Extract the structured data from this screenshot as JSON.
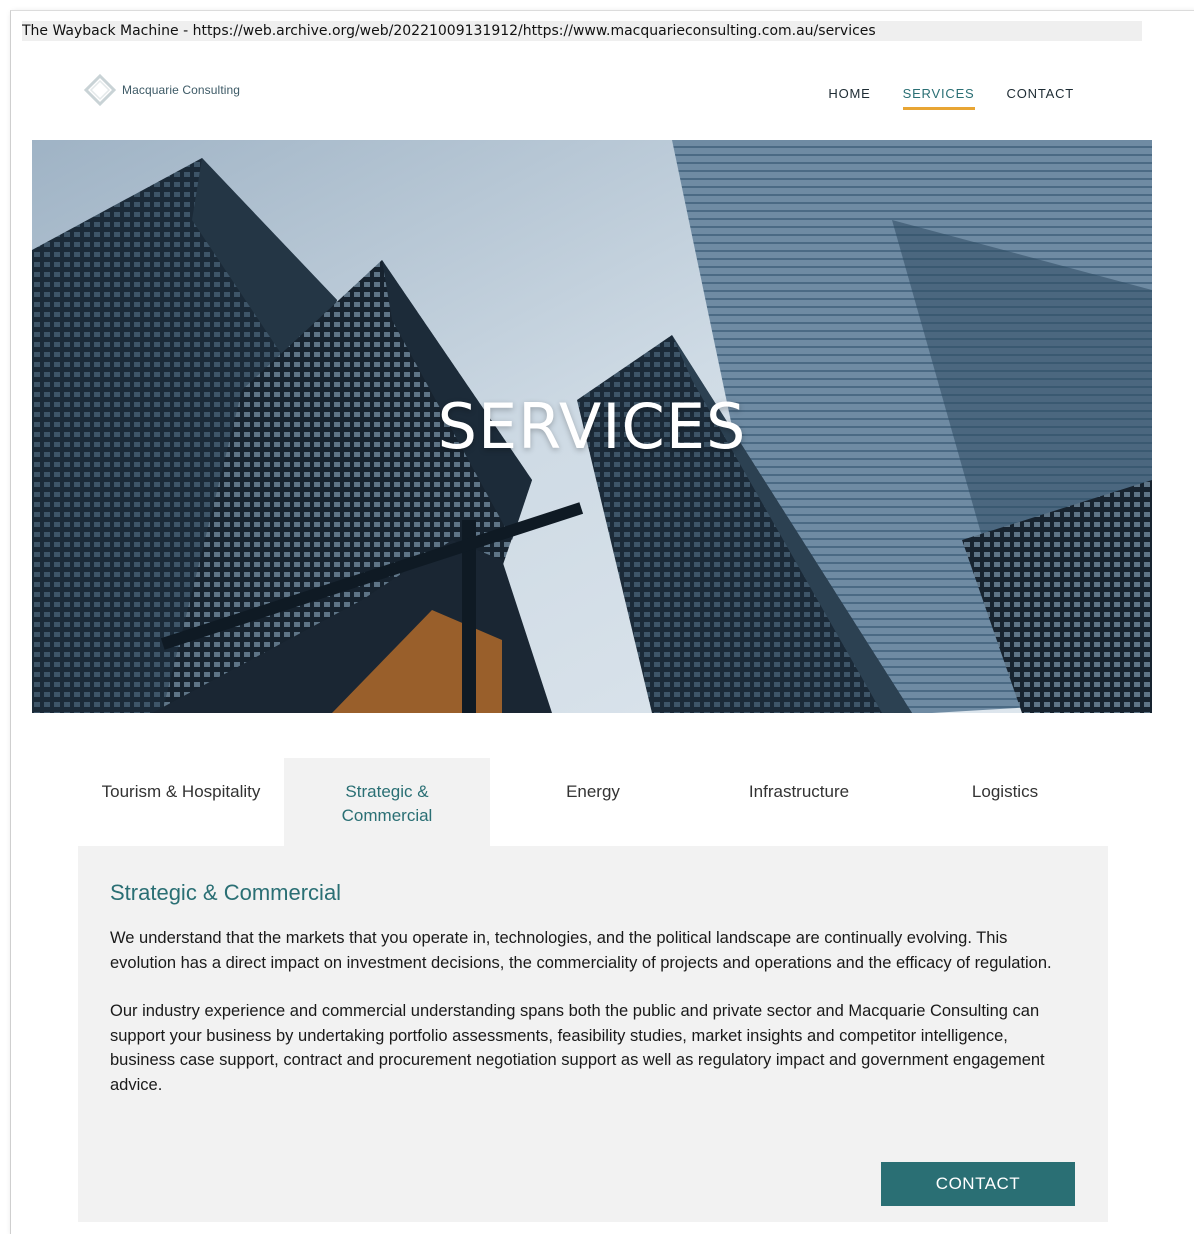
{
  "wayback": {
    "text": "The Wayback Machine - https://web.archive.org/web/20221009131912/https://www.macquarieconsulting.com.au/services"
  },
  "header": {
    "logo_text": "Macquarie Consulting",
    "nav": [
      {
        "label": "HOME",
        "active": false
      },
      {
        "label": "SERVICES",
        "active": true
      },
      {
        "label": "CONTACT",
        "active": false
      }
    ]
  },
  "hero": {
    "title": "SERVICES"
  },
  "tabs": [
    {
      "label": "Tourism & Hospitality",
      "active": false
    },
    {
      "label": "Strategic & Commercial",
      "active": true
    },
    {
      "label": "Energy",
      "active": false
    },
    {
      "label": "Infrastructure",
      "active": false
    },
    {
      "label": "Logistics",
      "active": false
    }
  ],
  "panel": {
    "title": "Strategic & Commercial",
    "paragraphs": [
      "We understand that the markets that you operate in, technologies, and the political landscape are continually evolving. This evolution has a direct impact on investment decisions, the commerciality of projects and operations and the efficacy of regulation.",
      "Our industry experience and commercial understanding spans both the public and private sector and Macquarie Consulting can support your business by undertaking portfolio assessments, feasibility studies, market insights and competitor intelligence, business case support, contract and procurement negotiation support as well as regulatory impact and government engagement advice."
    ],
    "button_label": "CONTACT"
  },
  "colors": {
    "accent": "#2a6f74",
    "nav_underline": "#e8a534",
    "panel_bg": "#f2f2f2"
  }
}
